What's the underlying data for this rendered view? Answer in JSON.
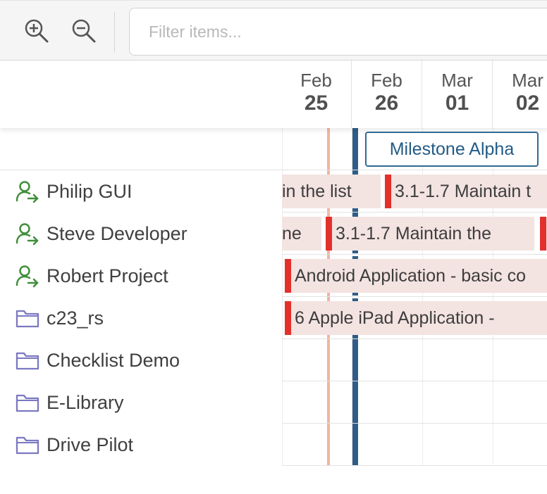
{
  "toolbar": {
    "zoom_in_icon": "zoom-in-icon",
    "zoom_out_icon": "zoom-out-icon",
    "filter_placeholder": "Filter items..."
  },
  "dates": [
    {
      "month": "Feb",
      "day": "25"
    },
    {
      "month": "Feb",
      "day": "26"
    },
    {
      "month": "Mar",
      "day": "01"
    },
    {
      "month": "Mar",
      "day": "02"
    }
  ],
  "milestone": {
    "label": "Milestone Alpha"
  },
  "rows": [
    {
      "name": "Philip GUI",
      "icon": "user-assign-icon"
    },
    {
      "name": "Steve Developer",
      "icon": "user-assign-icon"
    },
    {
      "name": "Robert Project",
      "icon": "user-assign-icon"
    },
    {
      "name": "c23_rs",
      "icon": "folder-icon"
    },
    {
      "name": "Checklist Demo",
      "icon": "folder-icon"
    },
    {
      "name": "E-Library",
      "icon": "folder-icon"
    },
    {
      "name": "Drive Pilot",
      "icon": "folder-icon"
    }
  ],
  "bars": {
    "philip_1": "in the list",
    "philip_2": "3.1-1.7 Maintain t",
    "steve_1": "ne",
    "steve_2": "3.1-1.7 Maintain the",
    "robert_1": "Android Application - basic co",
    "c23_1": "6 Apple iPad Application -"
  },
  "colors": {
    "accent": "#2f5d88",
    "task_flag": "#e3302b",
    "task_bar": "#f3e3e1",
    "user_icon": "#3f8f3a",
    "folder_icon": "#7b78c2",
    "today_line": "#f2b3a0"
  }
}
